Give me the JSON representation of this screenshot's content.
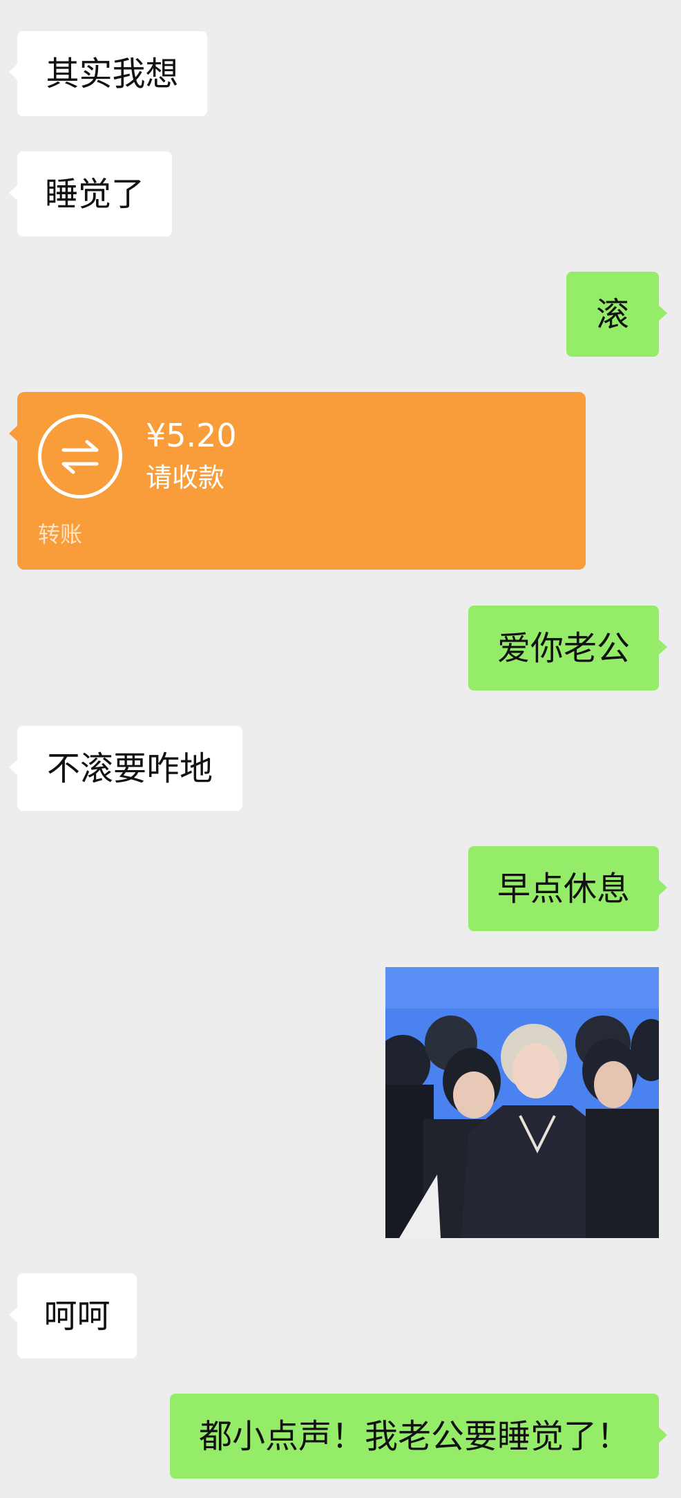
{
  "messages": [
    {
      "side": "left",
      "text": "其实我想"
    },
    {
      "side": "left",
      "text": "睡觉了"
    },
    {
      "side": "right",
      "text": "滚"
    },
    {
      "side": "left",
      "type": "transfer"
    },
    {
      "side": "right",
      "text": "爱你老公"
    },
    {
      "side": "left",
      "text": "不滚要咋地"
    },
    {
      "side": "right",
      "text": "早点休息"
    },
    {
      "side": "right",
      "type": "image"
    },
    {
      "side": "left",
      "text": "呵呵"
    },
    {
      "side": "right",
      "text": "都小点声！我老公要睡觉了！"
    }
  ],
  "transfer": {
    "amount": "¥5.20",
    "status": "请收款",
    "label": "转账",
    "icon": "transfer-arrows-icon"
  },
  "colors": {
    "background": "#ededed",
    "left_bubble": "#ffffff",
    "right_bubble": "#95ec69",
    "transfer_card": "#f89d3a"
  }
}
